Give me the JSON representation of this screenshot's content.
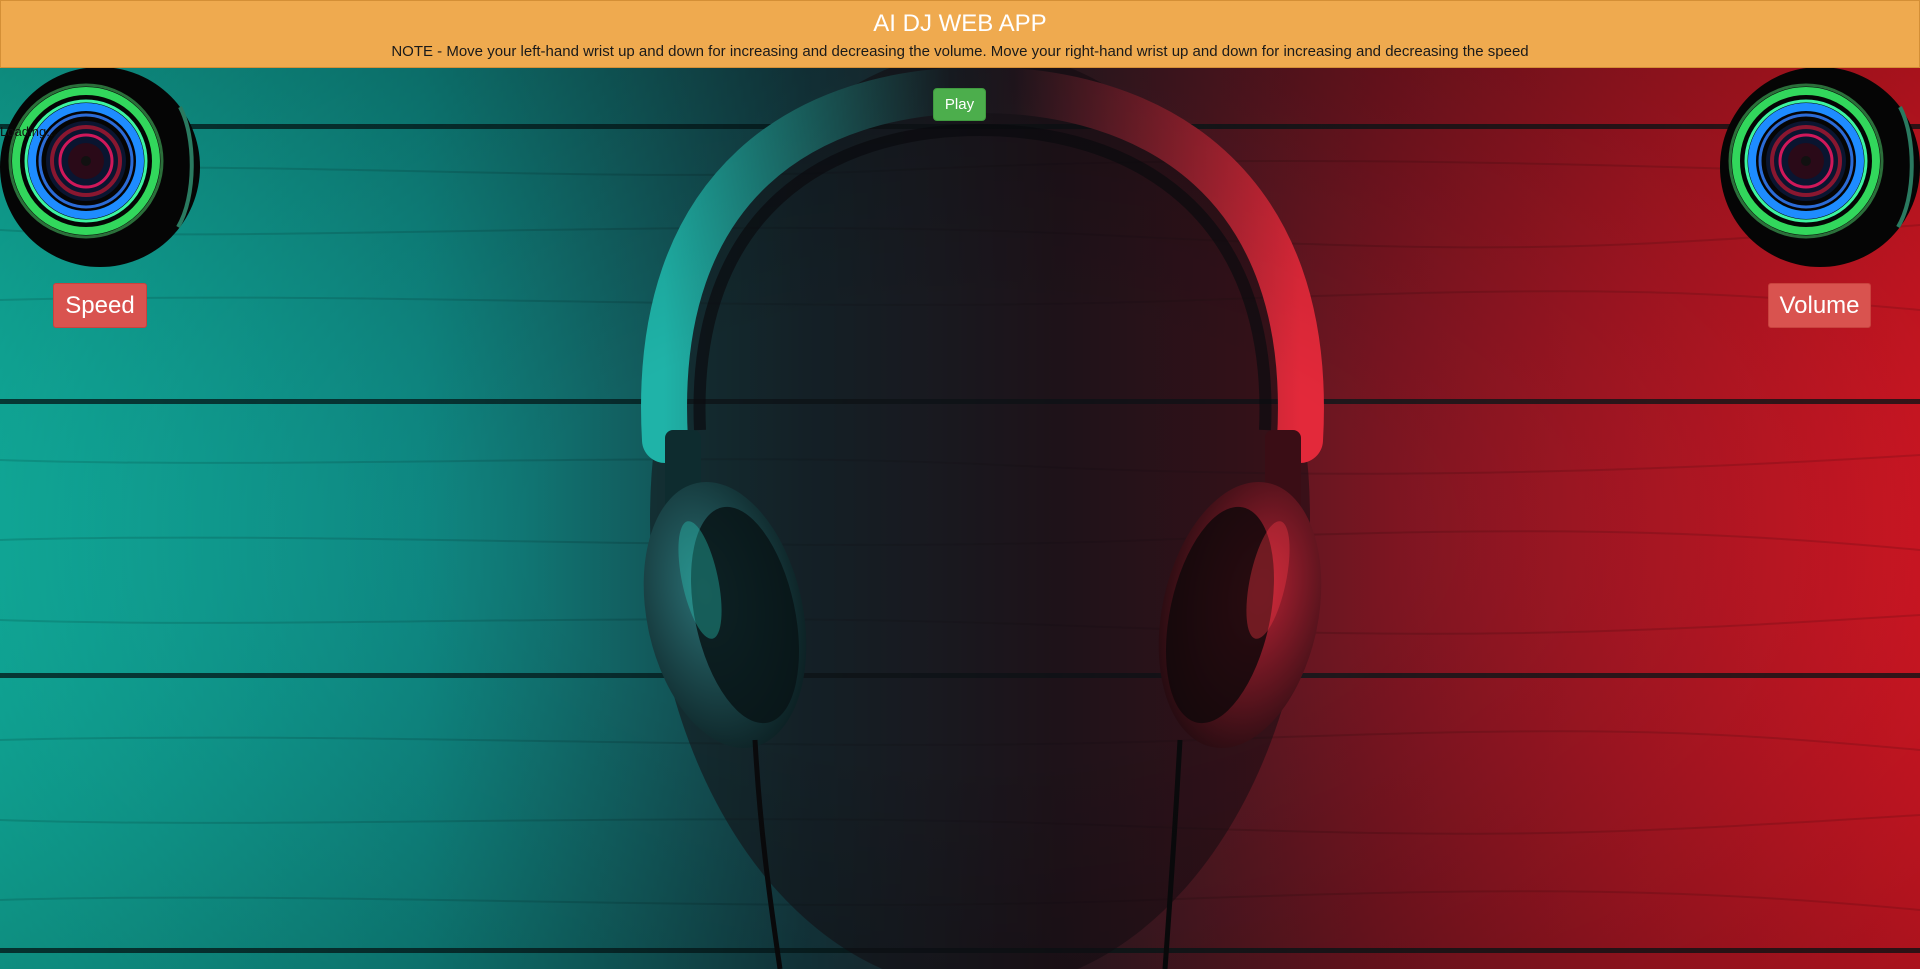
{
  "header": {
    "title": "AI DJ WEB APP",
    "note": "NOTE - Move your left-hand wrist up and down for increasing and decreasing the volume. Move your right-hand wrist up and down for increasing and decreasing the speed",
    "background_color": "#efaa4f"
  },
  "player": {
    "play_label": "Play",
    "play_color": "#4cae4c",
    "loading_text": "Loading..."
  },
  "controls": {
    "speed_label": "Speed",
    "volume_label": "Volume",
    "button_color": "#d9534f"
  },
  "icons": {
    "left_deck": "turntable-disc-icon",
    "right_deck": "turntable-disc-icon"
  },
  "background": {
    "description_colors": {
      "left": "#15c4b0",
      "right": "#f01a2a"
    }
  }
}
